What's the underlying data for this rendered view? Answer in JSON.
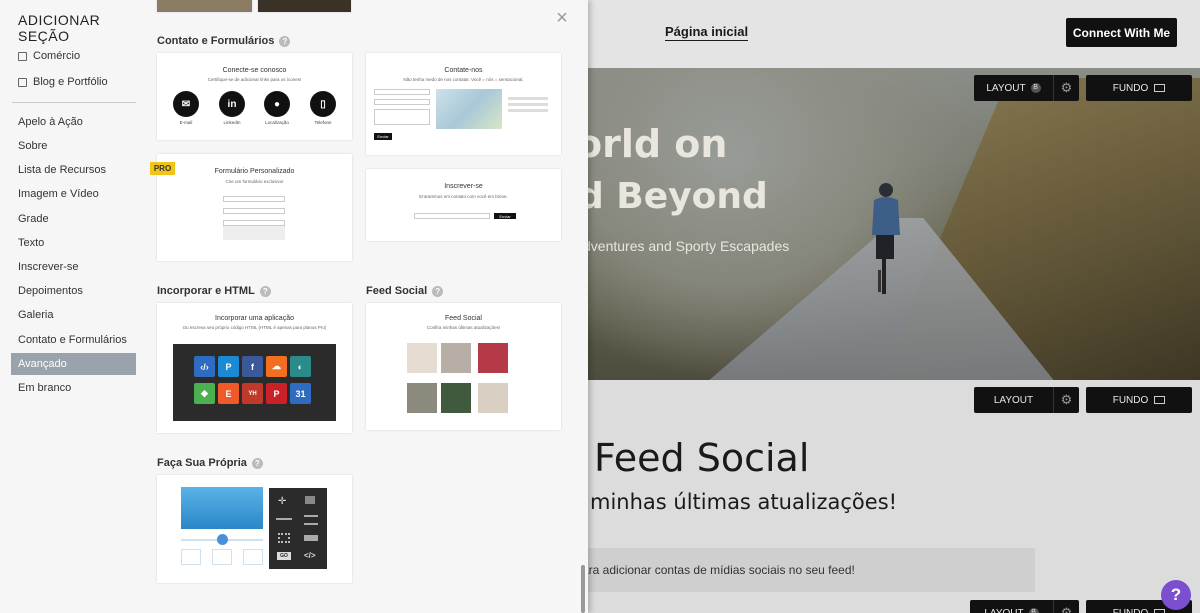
{
  "site": {
    "nav_home": "Página inicial",
    "connect": "Connect With Me",
    "hero_title1": "orld on",
    "hero_title2": "d Beyond",
    "hero_sub": "dventures and Sporty Escapades",
    "feed_title": "Feed Social",
    "feed_sub": "minhas últimas atualizações!",
    "feed_note": "ara adicionar contas de mídias sociais no seu feed!",
    "layout_label": "LAYOUT",
    "layout_badge": "B",
    "fundo_label": "FUNDO",
    "help": "?"
  },
  "panel": {
    "title": "ADICIONAR SEÇÃO",
    "top_categories": [
      "Comércio",
      "Blog e Portfólio"
    ],
    "sections": [
      "Apelo à Ação",
      "Sobre",
      "Lista de Recursos",
      "Imagem e Vídeo",
      "Grade",
      "Texto",
      "Inscrever-se",
      "Depoimentos",
      "Galeria",
      "Contato e Formulários",
      "Avançado",
      "Em branco"
    ],
    "active_section": "Avançado",
    "groups": {
      "contato": "Contato e Formulários",
      "incorporar": "Incorporar e HTML",
      "feed": "Feed Social",
      "propria": "Faça Sua Própria"
    },
    "cards": {
      "conecte": {
        "title": "Conecte-se conosco",
        "desc": "Certifique-se de adicionar links para os ícones!",
        "items": [
          "E-mail",
          "LinkedIn",
          "Localização",
          "Telefone"
        ]
      },
      "contate": {
        "title": "Contate-nos",
        "desc": "Não tenha medo de nos contatar. Você = nós = sensacional.",
        "button": "Enviar"
      },
      "formulario": {
        "title": "Formulário Personalizado",
        "desc": "Crie um formulário exclusivo!",
        "pro": "PRO"
      },
      "inscrever": {
        "title": "Inscrever-se",
        "desc": "Entraremos em contato com você em breve.",
        "button": "Enviar"
      },
      "aplicacao": {
        "title": "Incorporar uma aplicação",
        "desc": "Ou escreva seu próprio código HTML (HTML é apenas para planos Pro)"
      },
      "feed": {
        "title": "Feed Social",
        "desc": "Confira minhas últimas atualizações!"
      },
      "propria": {
        "go": "GO",
        "code": "</>"
      }
    }
  },
  "colors": {
    "active": "#9aa3ac",
    "pro": "#f0c419",
    "help": "#7c4fd0"
  }
}
